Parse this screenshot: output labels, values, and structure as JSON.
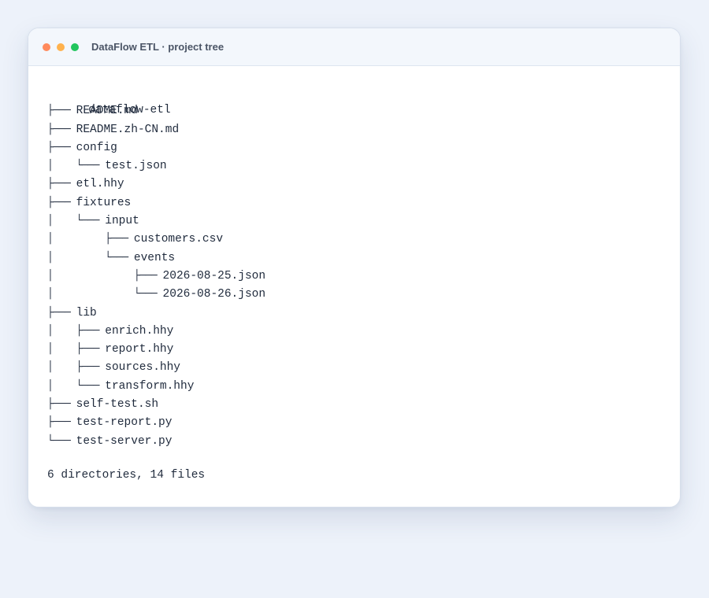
{
  "window": {
    "title": "DataFlow ETL · project tree",
    "traffic_lights": {
      "close": "#ff8a5c",
      "minimize": "#ffb24d",
      "zoom": "#21c55d"
    }
  },
  "tree": {
    "root": "dataflow-etl",
    "lines": [
      {
        "prefix": "├─── ",
        "name": "README.md"
      },
      {
        "prefix": "├─── ",
        "name": "README.zh-CN.md"
      },
      {
        "prefix": "├─── ",
        "name": "config"
      },
      {
        "prefix": "│    └─── ",
        "name": "test.json"
      },
      {
        "prefix": "├─── ",
        "name": "etl.hhy"
      },
      {
        "prefix": "├─── ",
        "name": "fixtures"
      },
      {
        "prefix": "│    └─── ",
        "name": "input"
      },
      {
        "prefix": "│         ├─── ",
        "name": "customers.csv"
      },
      {
        "prefix": "│         └─── ",
        "name": "events"
      },
      {
        "prefix": "│              ├─── ",
        "name": "2026-08-25.json"
      },
      {
        "prefix": "│              └─── ",
        "name": "2026-08-26.json"
      },
      {
        "prefix": "├─── ",
        "name": "lib"
      },
      {
        "prefix": "│    ├─── ",
        "name": "enrich.hhy"
      },
      {
        "prefix": "│    ├─── ",
        "name": "report.hhy"
      },
      {
        "prefix": "│    ├─── ",
        "name": "sources.hhy"
      },
      {
        "prefix": "│    └─── ",
        "name": "transform.hhy"
      },
      {
        "prefix": "├─── ",
        "name": "self-test.sh"
      },
      {
        "prefix": "├─── ",
        "name": "test-report.py"
      },
      {
        "prefix": "└─── ",
        "name": "test-server.py"
      }
    ],
    "summary": "6 directories, 14 files"
  }
}
